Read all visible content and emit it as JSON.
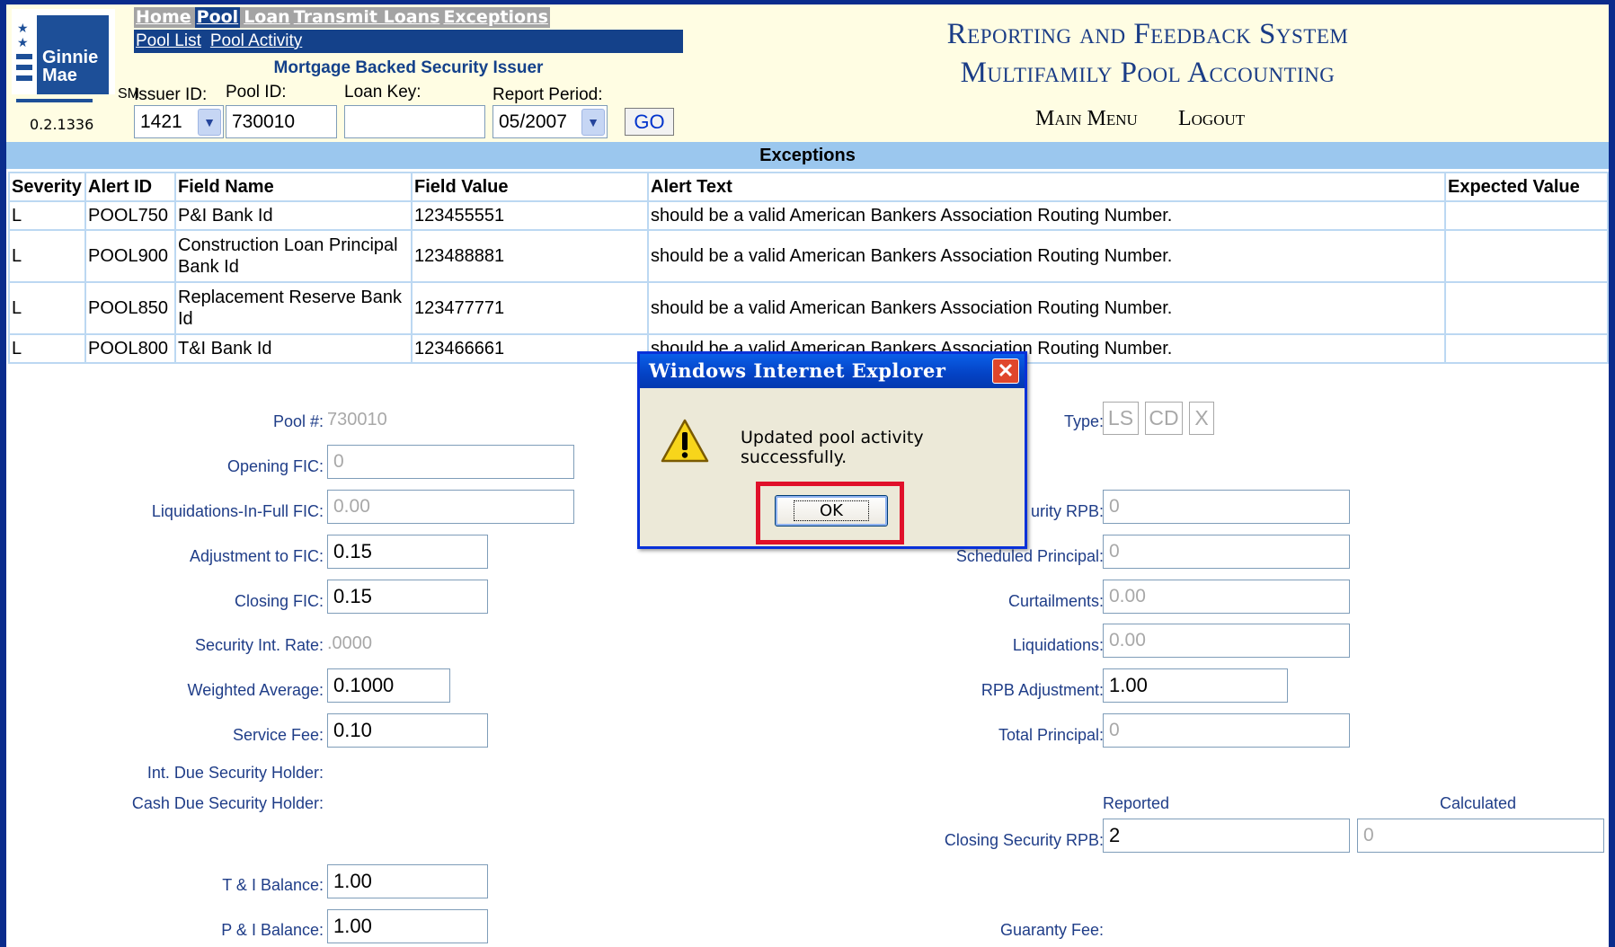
{
  "header": {
    "logo_text_line1": "Ginnie",
    "logo_text_line2": "Mae",
    "logo_sm": "SM",
    "version": "0.2.1336",
    "topnav": [
      "Home",
      "Pool",
      "Loan",
      "Transmit Loans",
      "Exceptions"
    ],
    "topnav_active": "Pool",
    "subnav": [
      "Pool List",
      "Pool Activity"
    ],
    "issuer_type": "Mortgage Backed Security Issuer",
    "issuer_id_label": "Issuer ID:",
    "issuer_id_value": "1421",
    "pool_id_label": "Pool ID:",
    "pool_id_value": "730010",
    "loan_key_label": "Loan Key:",
    "loan_key_value": "",
    "report_period_label": "Report Period:",
    "report_period_value": "05/2007",
    "go_label": "GO",
    "system_title_line1": "Reporting and Feedback System",
    "system_title_line2": "Multifamily Pool Accounting",
    "main_menu": "Main Menu",
    "logout": "Logout"
  },
  "exceptions": {
    "banner": "Exceptions",
    "columns": [
      "Severity",
      "Alert ID",
      "Field Name",
      "Field Value",
      "Alert Text",
      "Expected Value"
    ],
    "rows": [
      [
        "L",
        "POOL750",
        "P&I Bank Id",
        "123455551",
        "should be a valid American Bankers Association Routing Number.",
        ""
      ],
      [
        "L",
        "POOL900",
        "Construction Loan Principal Bank Id",
        "123488881",
        "should be a valid American Bankers Association Routing Number.",
        ""
      ],
      [
        "L",
        "POOL850",
        "Replacement Reserve Bank Id",
        "123477771",
        "should be a valid American Bankers Association Routing Number.",
        ""
      ],
      [
        "L",
        "POOL800",
        "T&I Bank Id",
        "123466661",
        "should be a valid American Bankers Association Routing Number.",
        ""
      ]
    ]
  },
  "form": {
    "pool_num_label": "Pool #:",
    "pool_num_value": "730010",
    "opening_fic_label": "Opening FIC:",
    "opening_fic_value": "0",
    "liq_in_full_label": "Liquidations-In-Full FIC:",
    "liq_in_full_value": "0.00",
    "adj_fic_label": "Adjustment to FIC:",
    "adj_fic_value": "0.15",
    "closing_fic_label": "Closing FIC:",
    "closing_fic_value": "0.15",
    "sec_int_rate_label": "Security Int. Rate:",
    "sec_int_rate_value": ".0000",
    "weighted_avg_label": "Weighted Average:",
    "weighted_avg_value": "0.1000",
    "service_fee_label": "Service Fee:",
    "service_fee_value": "0.10",
    "int_due_label": "Int. Due Security Holder:",
    "cash_due_label": "Cash Due Security Holder:",
    "ti_balance_label": "T & I Balance:",
    "ti_balance_value": "1.00",
    "pi_balance_label": "P & I Balance:",
    "pi_balance_value": "1.00",
    "type_label": "Type:",
    "type_options": [
      "LS",
      "CD",
      "X"
    ],
    "opening_rpb_label_partial": "urity RPB:",
    "opening_rpb_value": "0",
    "sched_principal_label": "Scheduled Principal:",
    "sched_principal_value": "0",
    "curtailments_label": "Curtailments:",
    "curtailments_value": "0.00",
    "liquidations_label": "Liquidations:",
    "liquidations_value": "0.00",
    "rpb_adj_label": "RPB Adjustment:",
    "rpb_adj_value": "1.00",
    "total_principal_label": "Total Principal:",
    "total_principal_value": "0",
    "reported_label": "Reported",
    "calculated_label": "Calculated",
    "closing_rpb_label": "Closing Security RPB:",
    "closing_rpb_reported": "2",
    "closing_rpb_calculated": "0",
    "guaranty_fee_label": "Guaranty Fee:"
  },
  "dialog": {
    "title": "Windows Internet Explorer",
    "message": "Updated pool activity successfully.",
    "ok_label": "OK",
    "icon": "warning-icon",
    "highlight_color": "#e0102a"
  },
  "colors": {
    "frame": "#0a2c8c",
    "header_bg": "#fffde3",
    "nav_blue": "#14418a",
    "exceptions_banner": "#9bc7ee"
  }
}
